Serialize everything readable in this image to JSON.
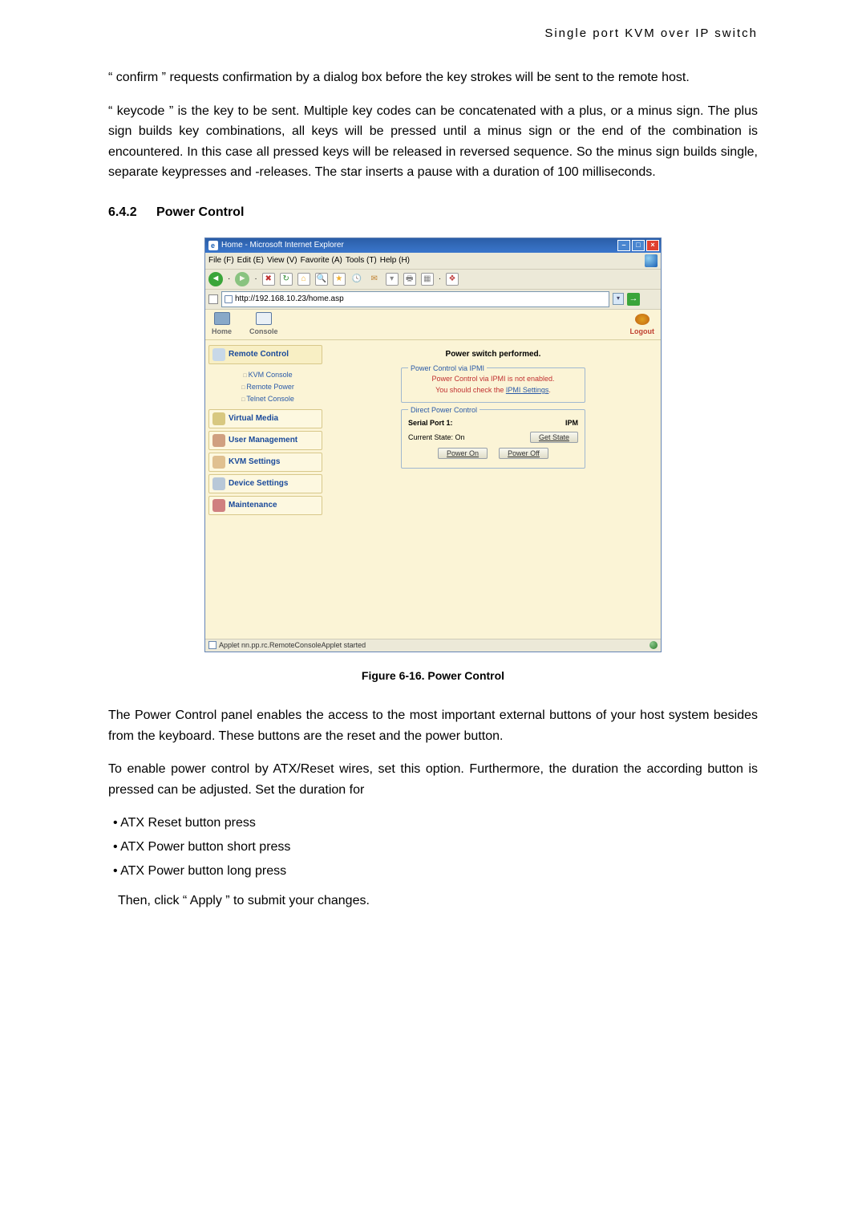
{
  "header": "Single port KVM over IP switch",
  "para_confirm": "“ confirm ” requests confirmation by a dialog box before the key strokes will be sent to the remote host.",
  "para_keycode": "“ keycode ” is the key to be sent. Multiple key codes can be concatenated with a plus, or a minus sign. The plus sign builds key combinations, all keys will be pressed until a minus sign or the end of the combination is encountered. In this case all pressed keys will be released in reversed sequence. So the minus sign builds single, separate keypresses and -releases. The star inserts a pause with a duration of 100 milliseconds.",
  "section_num": "6.4.2",
  "section_title": "Power Control",
  "figure_caption": "Figure 6-16. Power Control",
  "para_panel": "The Power Control panel enables the access to the most important external buttons of your host system besides from the keyboard. These buttons are the reset and the power button.",
  "para_enable": "To enable power control by ATX/Reset wires, set this option. Furthermore, the duration the according button is pressed can be adjusted. Set the duration for",
  "bullets": [
    "ATX Reset button press",
    "ATX Power button short press",
    "ATX Power button long press"
  ],
  "apply_line": "Then, click “ Apply ” to submit your changes.",
  "browser": {
    "title": "Home - Microsoft Internet Explorer",
    "menus": [
      "File (F)",
      "Edit (E)",
      "View (V)",
      "Favorite (A)",
      "Tools (T)",
      "Help (H)"
    ],
    "url": "http://192.168.10.23/home.asp",
    "topnav": {
      "home": "Home",
      "console": "Console",
      "logout": "Logout"
    },
    "sidebar": {
      "remote_control": "Remote Control",
      "subs": [
        "KVM Console",
        "Remote Power",
        "Telnet Console"
      ],
      "virtual_media": "Virtual Media",
      "user_mgmt": "User Management",
      "kvm_settings": "KVM Settings",
      "device_settings": "Device Settings",
      "maintenance": "Maintenance"
    },
    "panel": {
      "status": "Power switch performed.",
      "ipmi_legend": "Power Control via IPMI",
      "ipmi_line1": "Power Control via IPMI is not enabled.",
      "ipmi_line2a": "You should check the ",
      "ipmi_link": "IPMI Settings",
      "direct_legend": "Direct Power Control",
      "serial_label": "Serial Port 1:",
      "serial_val": "IPM",
      "state_label": "Current State: On",
      "btn_getstate": "Get State",
      "btn_on": "Power On",
      "btn_off": "Power Off"
    },
    "statusbar": "Applet nn.pp.rc.RemoteConsoleApplet started"
  }
}
